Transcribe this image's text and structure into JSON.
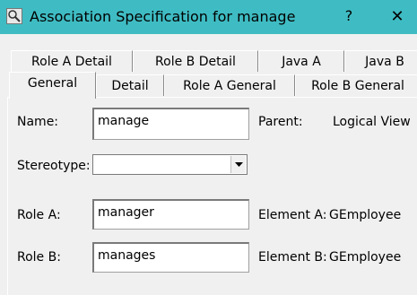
{
  "window": {
    "title": "Association Specification for manage",
    "help_label": "?",
    "close_label": "✕"
  },
  "tabs": {
    "row1": [
      "Role A Detail",
      "Role B Detail",
      "Java A",
      "Java B"
    ],
    "row2": [
      "General",
      "Detail",
      "Role A General",
      "Role B General"
    ],
    "active": "General"
  },
  "form": {
    "name_label": "Name:",
    "name_value": "manage",
    "parent_label": "Parent:",
    "parent_value": "Logical View",
    "stereotype_label": "Stereotype:",
    "stereotype_value": "",
    "role_a_label": "Role A:",
    "role_a_value": "manager",
    "element_a_label": "Element A:",
    "element_a_value": "GEmployee",
    "role_b_label": "Role B:",
    "role_b_value": "manages",
    "element_b_label": "Element B:",
    "element_b_value": "GEmployee"
  }
}
